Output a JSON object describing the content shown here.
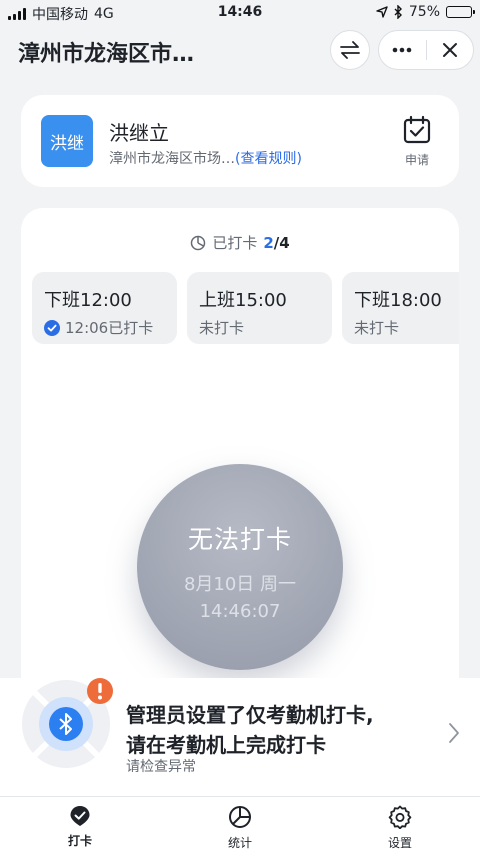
{
  "status_bar": {
    "carrier": "中国移动",
    "network": "4G",
    "time": "14:46",
    "battery": "75%",
    "battery_level": 0.75
  },
  "nav": {
    "title": "漳州市龙海区市…"
  },
  "user": {
    "avatar_text": "洪继",
    "name": "洪继立",
    "org": "漳州市龙海区市场…",
    "rule_link": "(查看规则)",
    "apply_label": "申请"
  },
  "progress": {
    "label": "已打卡",
    "done": "2",
    "total": "/4"
  },
  "shifts": [
    {
      "title": "下班12:00",
      "status": "12:06已打卡",
      "checked": true
    },
    {
      "title": "上班15:00",
      "status": "未打卡",
      "checked": false
    },
    {
      "title": "下班18:00",
      "status": "未打卡",
      "checked": false
    }
  ],
  "punch": {
    "label": "无法打卡",
    "date": "8月10日 周一",
    "time": "14:46:07"
  },
  "alert": {
    "line1": "管理员设置了仅考勤机打卡,",
    "line2": "请在考勤机上完成打卡",
    "sub": "请检查异常"
  },
  "tabs": [
    {
      "label": "打卡",
      "icon": "check-shield-icon",
      "active": true
    },
    {
      "label": "统计",
      "icon": "pie-chart-icon",
      "active": false
    },
    {
      "label": "设置",
      "icon": "gear-icon",
      "active": false
    }
  ],
  "colors": {
    "accent": "#2b6de5",
    "avatar": "#3a90ee",
    "warning": "#ee6b3a",
    "punch_disabled": "#9ea3b1"
  }
}
